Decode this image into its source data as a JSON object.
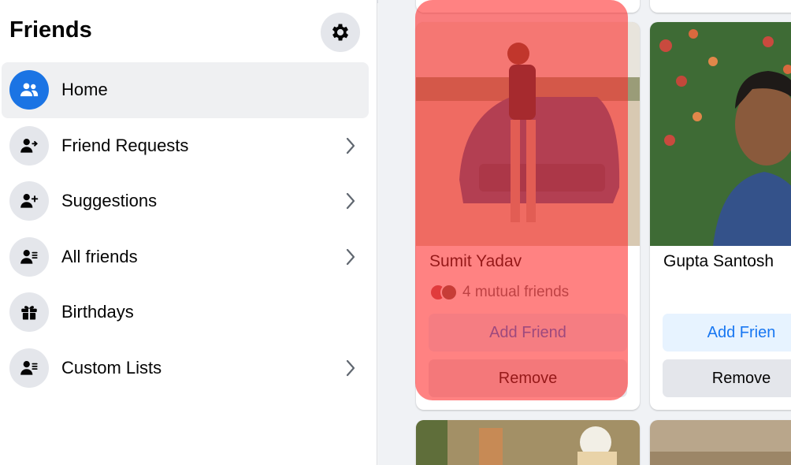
{
  "sidebar": {
    "title": "Friends",
    "items": [
      {
        "label": "Home",
        "icon": "people-icon",
        "active": true,
        "chevron": false
      },
      {
        "label": "Friend Requests",
        "icon": "person-arrow-icon",
        "active": false,
        "chevron": true
      },
      {
        "label": "Suggestions",
        "icon": "person-add-icon",
        "active": false,
        "chevron": true
      },
      {
        "label": "All friends",
        "icon": "person-list-icon",
        "active": false,
        "chevron": true
      },
      {
        "label": "Birthdays",
        "icon": "gift-icon",
        "active": false,
        "chevron": false
      },
      {
        "label": "Custom Lists",
        "icon": "person-list-icon",
        "active": false,
        "chevron": true
      }
    ]
  },
  "cards": [
    {
      "name": "Sumit Yadav",
      "mutual": "4 mutual friends",
      "add_label": "Add Friend",
      "remove_label": "Remove"
    },
    {
      "name": "Gupta Santosh",
      "mutual": "",
      "add_label": "Add Frien",
      "remove_label": "Remove"
    }
  ],
  "colors": {
    "accent": "#1b74e4",
    "highlight": "#ff2828",
    "background": "#f0f2f5"
  }
}
